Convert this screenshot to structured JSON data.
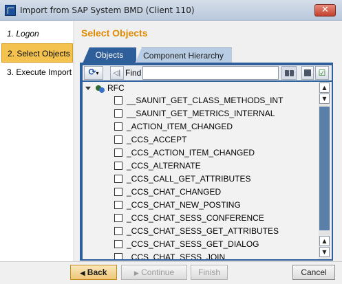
{
  "window": {
    "title": "Import from SAP System BMD (Client 110)",
    "close_label": "✕"
  },
  "nav": {
    "items": [
      {
        "label": "1. Logon",
        "active": false
      },
      {
        "label": "2. Select Objects",
        "active": true
      },
      {
        "label": "3. Execute Import",
        "active": false
      }
    ]
  },
  "main": {
    "title": "Select Objects"
  },
  "tabs": [
    {
      "label": "Objects",
      "active": true
    },
    {
      "label": "Component Hierarchy",
      "active": false
    }
  ],
  "toolbar": {
    "find_label": "Find",
    "find_value": ""
  },
  "tree": {
    "root_label": "RFC",
    "items": [
      "__SAUNIT_GET_CLASS_METHODS_INT",
      "__SAUNIT_GET_METRICS_INTERNAL",
      "_ACTION_ITEM_CHANGED",
      "_CCS_ACCEPT",
      "_CCS_ACTION_ITEM_CHANGED",
      "_CCS_ALTERNATE",
      "_CCS_CALL_GET_ATTRIBUTES",
      "_CCS_CHAT_CHANGED",
      "_CCS_CHAT_NEW_POSTING",
      "_CCS_CHAT_SESS_CONFERENCE",
      "_CCS_CHAT_SESS_GET_ATTRIBUTES",
      "_CCS_CHAT_SESS_GET_DIALOG",
      "_CCS_CHAT_SESS_JOIN"
    ]
  },
  "buttons": {
    "back": "Back",
    "continue": "Continue",
    "finish": "Finish",
    "cancel": "Cancel"
  },
  "colors": {
    "accent": "#e08a00",
    "panel_blue": "#2f5f9b",
    "active_nav": "#f4c24e"
  }
}
